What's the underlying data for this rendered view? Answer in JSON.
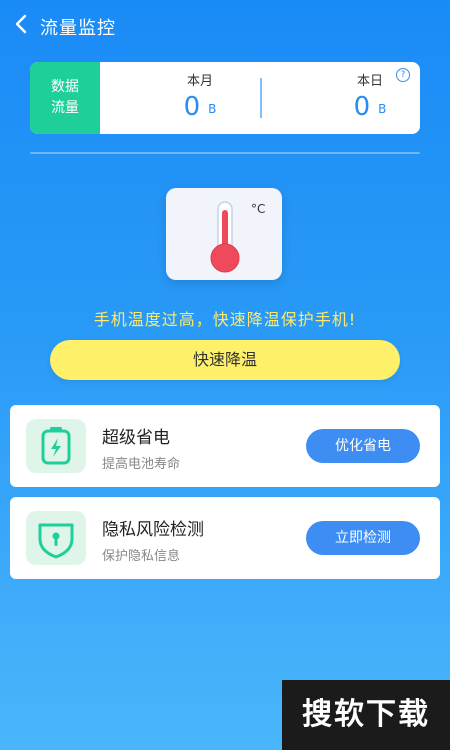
{
  "header": {
    "title": "流量监控"
  },
  "data_card": {
    "tag_line1": "数据",
    "tag_line2": "流量",
    "month": {
      "label": "本月",
      "value": "0",
      "unit": "B"
    },
    "day": {
      "label": "本日",
      "value": "0",
      "unit": "B"
    },
    "help_symbol": "?"
  },
  "thermo": {
    "unit_symbol": "°C"
  },
  "warning_text": "手机温度过高，快速降温保护手机!",
  "cool_button_label": "快速降温",
  "features": [
    {
      "title": "超级省电",
      "subtitle": "提高电池寿命",
      "button": "优化省电",
      "icon": "battery-icon"
    },
    {
      "title": "隐私风险检测",
      "subtitle": "保护隐私信息",
      "button": "立即检测",
      "icon": "shield-lock-icon"
    }
  ],
  "watermark": "搜软下载",
  "colors": {
    "background_top": "#1a8bf6",
    "accent_green": "#1fcf9a",
    "accent_blue": "#3d8df2",
    "warning_yellow": "#ffe86b",
    "button_yellow": "#fff06a",
    "thermo_red": "#ef4a5c"
  }
}
